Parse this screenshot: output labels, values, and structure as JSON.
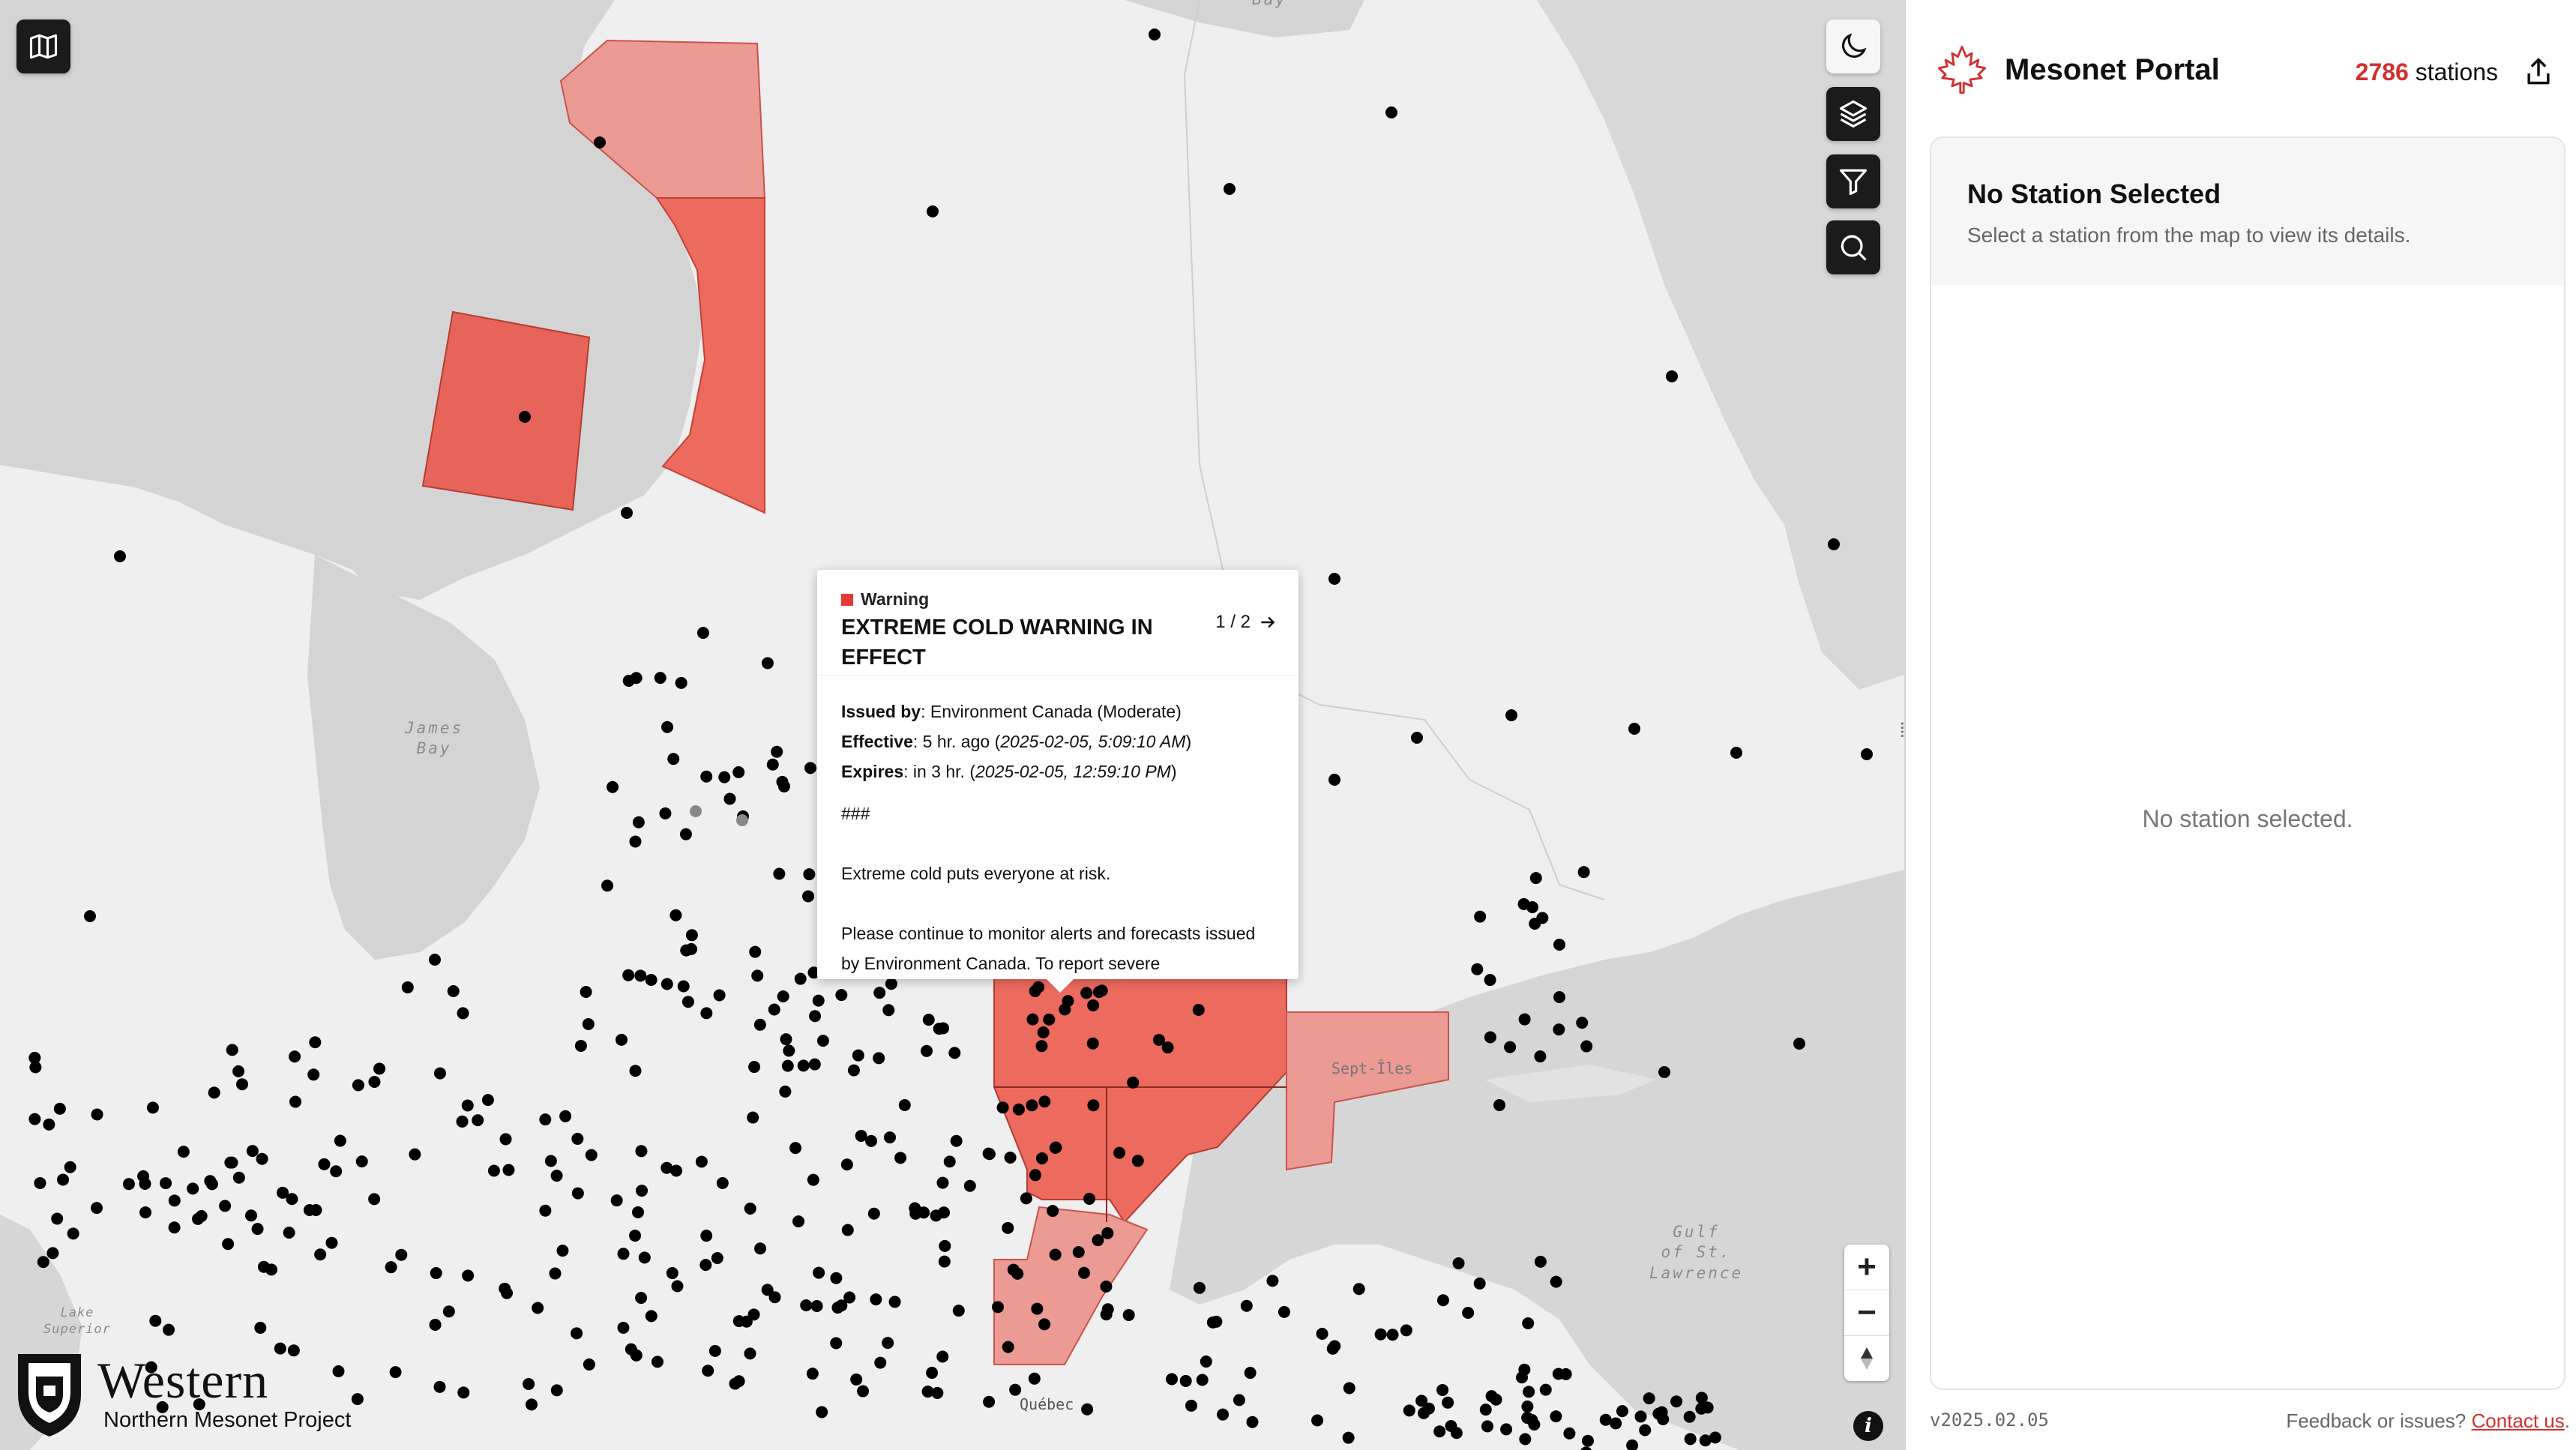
{
  "map": {
    "labels": {
      "bay_top": "Bay",
      "james_bay": [
        "James",
        "Bay"
      ],
      "lake_superior": [
        "Lake",
        "Superior"
      ],
      "gulf": [
        "Gulf",
        "of St.",
        "Lawrence"
      ],
      "quebec": "Québec",
      "sept_iles": "Sept-Îles"
    },
    "controls": {
      "basemap": "map-icon",
      "theme": "moon-icon",
      "layers": "layers-icon",
      "filter": "filter-icon",
      "search": "search-icon",
      "zoom_in": "+",
      "zoom_out": "−",
      "compass": "compass-icon",
      "info": "i"
    },
    "logo": {
      "name": "Western",
      "subtitle": "Northern Mesonet Project"
    },
    "colors": {
      "warning_fill": "#ec6a5e",
      "warning_light": "#eb9a94",
      "station": "#000000",
      "water": "#d5d5d5",
      "land": "#efefef"
    }
  },
  "popup": {
    "severity": "Warning",
    "title": "EXTREME COLD WARNING IN EFFECT",
    "pager": "1 / 2",
    "issued_label": "Issued by",
    "issued_value": ": Environment Canada (Moderate)",
    "effective_label": "Effective",
    "effective_value": ": 5 hr. ago (",
    "effective_time": "2025-02-05, 5:09:10 AM",
    "expires_label": "Expires",
    "expires_value": ": in 3 hr. (",
    "expires_time": "2025-02-05, 12:59:10 PM",
    "close_paren": ")",
    "hash": "###",
    "line1": "Extreme cold puts everyone at risk.",
    "line2": "Please continue to monitor alerts and forecasts issued by Environment Canada. To report severe"
  },
  "sidebar": {
    "brand": "Mesonet Portal",
    "station_count": "2786",
    "station_label": "stations",
    "card_title": "No Station Selected",
    "card_desc": "Select a station from the map to view its details.",
    "empty_text": "No station selected.",
    "version": "v2025.02.05",
    "feedback": "Feedback or issues? ",
    "contact": "Contact us",
    "period": "."
  }
}
